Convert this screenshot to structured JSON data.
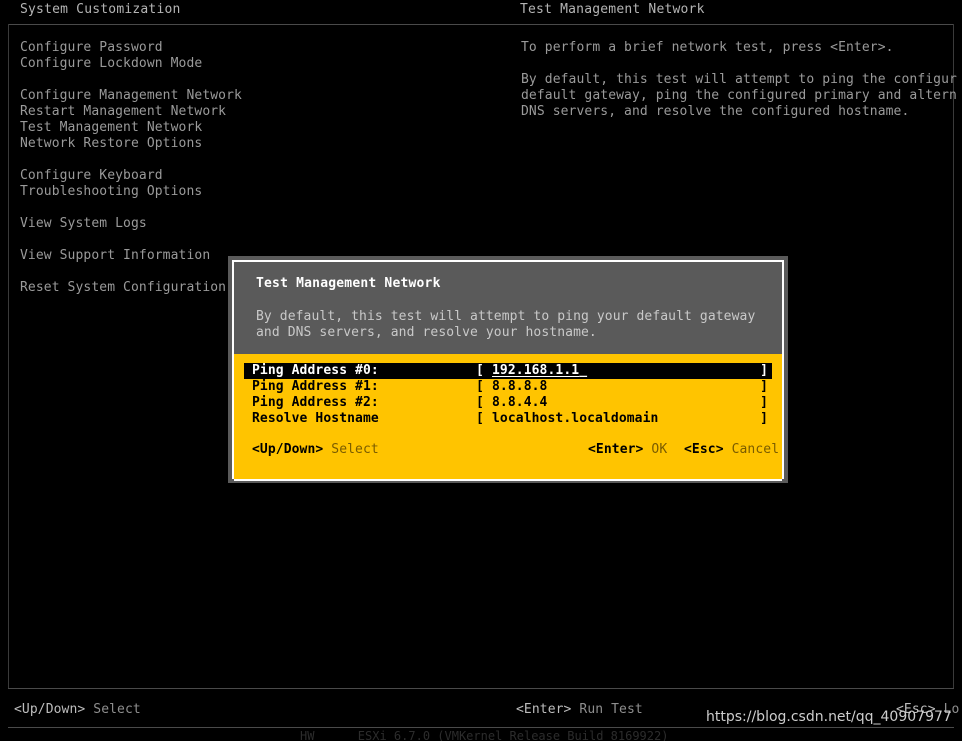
{
  "header": {
    "left_title": "System Customization",
    "right_title": "Test Management Network"
  },
  "menu": {
    "groups": [
      {
        "items": [
          {
            "label": "Configure Password"
          },
          {
            "label": "Configure Lockdown Mode"
          }
        ]
      },
      {
        "items": [
          {
            "label": "Configure Management Network"
          },
          {
            "label": "Restart Management Network"
          },
          {
            "label": "Test Management Network"
          },
          {
            "label": "Network Restore Options"
          }
        ]
      },
      {
        "items": [
          {
            "label": "Configure Keyboard"
          },
          {
            "label": "Troubleshooting Options"
          }
        ]
      },
      {
        "items": [
          {
            "label": "View System Logs"
          }
        ]
      },
      {
        "items": [
          {
            "label": "View Support Information"
          }
        ]
      },
      {
        "items": [
          {
            "label": "Reset System Configuration"
          }
        ]
      }
    ]
  },
  "detail": {
    "paragraphs": [
      [
        "To perform a brief network test, press <Enter>."
      ],
      [
        "By default, this test will attempt to ping the configur",
        "default gateway, ping the configured primary and altern",
        "DNS servers, and resolve the configured hostname."
      ]
    ]
  },
  "dialog": {
    "title": "Test Management Network",
    "description": [
      "By default, this test will attempt to ping your default gateway",
      "and DNS servers, and resolve your hostname."
    ],
    "fields": [
      {
        "label": "Ping Address #0:",
        "bracket_open": "[",
        "value": "192.168.1.1",
        "cursor": "_",
        "bracket_close": "]",
        "selected": true
      },
      {
        "label": "Ping Address #1:",
        "bracket_open": "[",
        "value": "8.8.8.8",
        "cursor": "",
        "bracket_close": "]",
        "selected": false
      },
      {
        "label": "Ping Address #2:",
        "bracket_open": "[",
        "value": "8.8.4.4",
        "cursor": "",
        "bracket_close": "]",
        "selected": false
      },
      {
        "label": "Resolve Hostname",
        "bracket_open": "[",
        "value": "localhost.localdomain",
        "cursor": "",
        "bracket_close": "]",
        "selected": false
      }
    ],
    "hints": [
      {
        "key": "<Up/Down>",
        "action": " Select"
      },
      {
        "key": "<Enter>",
        "action": " OK"
      },
      {
        "key": "<Esc>",
        "action": " Cancel"
      }
    ]
  },
  "statusbar": {
    "hints": [
      {
        "key": "<Up/Down>",
        "action": " Select"
      },
      {
        "key": "<Enter>",
        "action": " Run Test"
      },
      {
        "key": "<Esc>",
        "action": " Lo"
      }
    ]
  },
  "footer_strip": {
    "text": "HW      ESXi 6.7.0 (VMKernel Release Build 8169922)"
  },
  "watermark": {
    "text": "https://blog.csdn.net/qq_40907977"
  },
  "colors": {
    "background": "#000000",
    "text": "#9a9a9a",
    "dialog_header": "#5a5a5a",
    "dialog_body_accent": "#ffc400",
    "dialog_border": "#ffffff",
    "selection_bg": "#000000",
    "selection_fg": "#ffffff"
  }
}
